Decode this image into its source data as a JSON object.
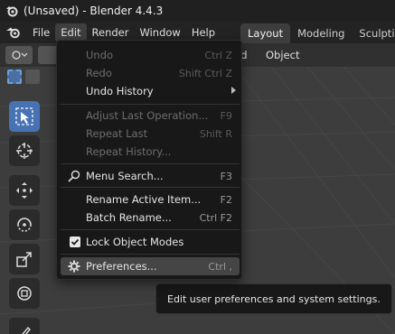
{
  "window": {
    "title": "(Unsaved) - Blender 4.4.3"
  },
  "menubar": {
    "items": [
      "File",
      "Edit",
      "Render",
      "Window",
      "Help"
    ],
    "active": "Edit"
  },
  "workspaces": {
    "tabs": [
      "Layout",
      "Modeling",
      "Sculpti"
    ],
    "active": "Layout"
  },
  "viewport_header": {
    "menu_partial": "ld",
    "object_menu": "Object"
  },
  "edit_menu": {
    "items": [
      {
        "label": "Undo",
        "shortcut": "Ctrl Z",
        "disabled": true
      },
      {
        "label": "Redo",
        "shortcut": "Shift Ctrl Z",
        "disabled": true
      },
      {
        "label": "Undo History",
        "shortcut": "",
        "disabled": false,
        "submenu": true
      },
      {
        "label": "Adjust Last Operation...",
        "shortcut": "F9",
        "disabled": true
      },
      {
        "label": "Repeat Last",
        "shortcut": "Shift R",
        "disabled": true
      },
      {
        "label": "Repeat History...",
        "shortcut": "",
        "disabled": true
      },
      {
        "label": "Menu Search...",
        "shortcut": "F3",
        "disabled": false,
        "icon": "search-icon"
      },
      {
        "label": "Rename Active Item...",
        "shortcut": "F2",
        "disabled": false
      },
      {
        "label": "Batch Rename...",
        "shortcut": "Ctrl F2",
        "disabled": false
      },
      {
        "label": "Lock Object Modes",
        "shortcut": "",
        "disabled": false,
        "checked": true
      },
      {
        "label": "Preferences...",
        "shortcut": "Ctrl ,",
        "disabled": false,
        "icon": "gear-icon",
        "hover": true
      }
    ]
  },
  "tooltip": {
    "text": "Edit user preferences and system settings."
  },
  "colors": {
    "accent": "#4772b3",
    "menu_bg": "#181818",
    "hover": "#454545"
  }
}
